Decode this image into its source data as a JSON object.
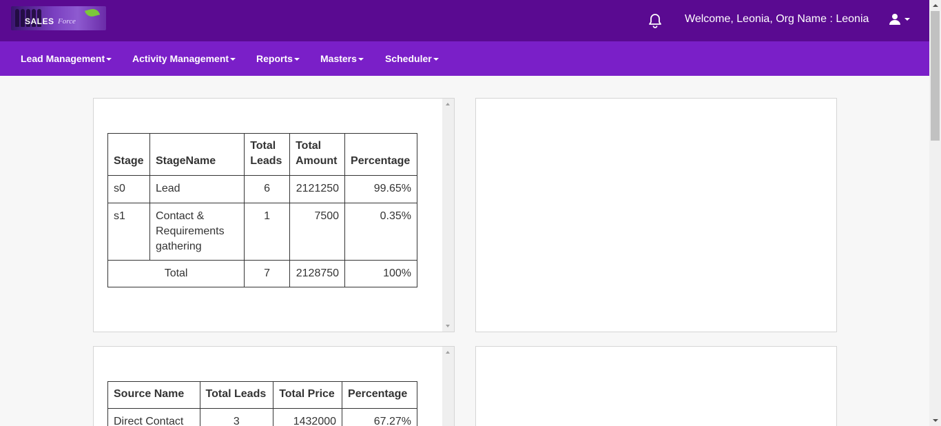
{
  "header": {
    "logo": {
      "brand": "SALES",
      "brand_script": "Force"
    },
    "bell_icon": "bell-icon",
    "welcome_text": "Welcome, Leonia, Org Name : Leonia",
    "user_icon": "user-icon"
  },
  "nav": {
    "items": [
      {
        "label": "Lead Management"
      },
      {
        "label": "Activity Management"
      },
      {
        "label": "Reports"
      },
      {
        "label": "Masters"
      },
      {
        "label": "Scheduler"
      }
    ]
  },
  "stage_table": {
    "headers": [
      "Stage",
      "StageName",
      "Total Leads",
      "Total Amount",
      "Percentage"
    ],
    "rows": [
      {
        "stage": "s0",
        "name": "Lead",
        "leads": "6",
        "amount": "2121250",
        "percentage": "99.65%"
      },
      {
        "stage": "s1",
        "name": "Contact & Requirements gathering",
        "leads": "1",
        "amount": "7500",
        "percentage": "0.35%"
      }
    ],
    "total": {
      "label": "Total",
      "leads": "7",
      "amount": "2128750",
      "percentage": "100%"
    }
  },
  "source_table": {
    "headers": [
      "Source Name",
      "Total Leads",
      "Total Price",
      "Percentage"
    ],
    "rows": [
      {
        "name": "Direct Contact",
        "leads": "3",
        "price": "1432000",
        "percentage": "67.27%"
      }
    ]
  },
  "colors": {
    "topbar": "#5a0a91",
    "navbar": "#7a1fc8",
    "page_background": "#f7f7f7"
  }
}
